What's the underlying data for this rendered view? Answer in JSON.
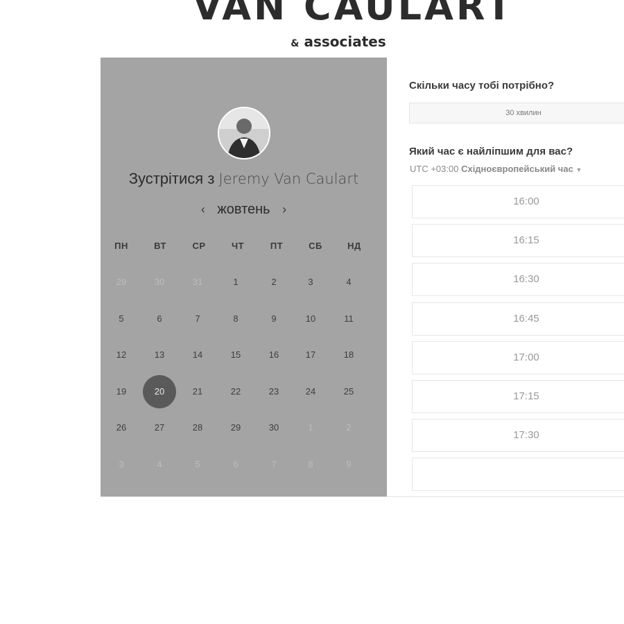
{
  "brand": {
    "title": "VAN CAULART",
    "sub_amp": "&",
    "sub_text": "associates"
  },
  "calendar": {
    "meet_prefix": "Зустрітися з",
    "person": "Jeremy Van Caulart",
    "month": "жовтень",
    "prev": "‹",
    "next": "›",
    "weekdays": [
      "ПН",
      "ВТ",
      "СР",
      "ЧТ",
      "ПТ",
      "СБ",
      "НД"
    ],
    "weeks": [
      [
        {
          "d": "29",
          "m": true
        },
        {
          "d": "30",
          "m": true
        },
        {
          "d": "31",
          "m": true
        },
        {
          "d": "1"
        },
        {
          "d": "2"
        },
        {
          "d": "3"
        },
        {
          "d": "4"
        }
      ],
      [
        {
          "d": "5"
        },
        {
          "d": "6"
        },
        {
          "d": "7"
        },
        {
          "d": "8"
        },
        {
          "d": "9"
        },
        {
          "d": "10"
        },
        {
          "d": "11"
        }
      ],
      [
        {
          "d": "12"
        },
        {
          "d": "13"
        },
        {
          "d": "14"
        },
        {
          "d": "15"
        },
        {
          "d": "16"
        },
        {
          "d": "17"
        },
        {
          "d": "18"
        }
      ],
      [
        {
          "d": "19"
        },
        {
          "d": "20",
          "s": true
        },
        {
          "d": "21"
        },
        {
          "d": "22"
        },
        {
          "d": "23"
        },
        {
          "d": "24"
        },
        {
          "d": "25"
        }
      ],
      [
        {
          "d": "26"
        },
        {
          "d": "27"
        },
        {
          "d": "28"
        },
        {
          "d": "29"
        },
        {
          "d": "30"
        },
        {
          "d": "1",
          "m": true
        },
        {
          "d": "2",
          "m": true
        }
      ],
      [
        {
          "d": "3",
          "m": true
        },
        {
          "d": "4",
          "m": true
        },
        {
          "d": "5",
          "m": true
        },
        {
          "d": "6",
          "m": true
        },
        {
          "d": "7",
          "m": true
        },
        {
          "d": "8",
          "m": true
        },
        {
          "d": "9",
          "m": true
        }
      ]
    ]
  },
  "booking": {
    "duration_question": "Скільки часу тобі потрібно?",
    "duration_value": "30 хвилин",
    "time_question": "Який час є найліпшим для вас?",
    "tz_offset": "UTC +03:00",
    "tz_name": "Східноєвропейський час",
    "tz_caret": "▼",
    "slots": [
      "16:00",
      "16:15",
      "16:30",
      "16:45",
      "17:00",
      "17:15",
      "17:30",
      ""
    ]
  }
}
